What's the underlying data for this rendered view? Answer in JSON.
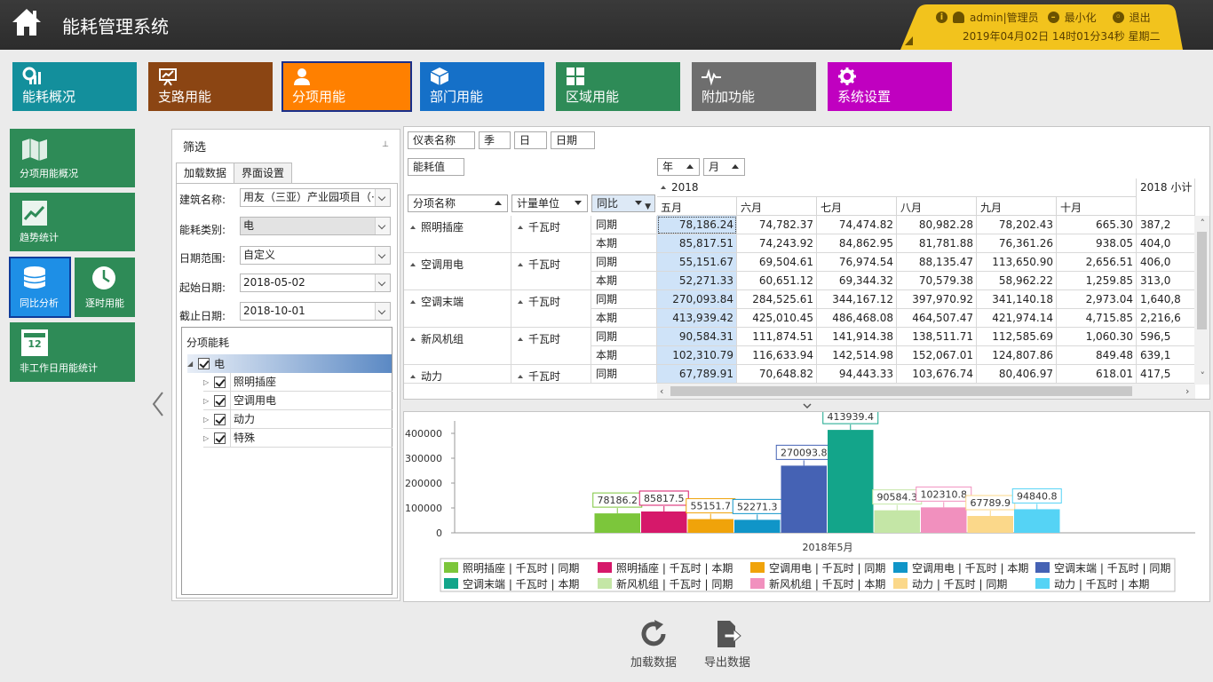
{
  "header": {
    "app_title": "能耗管理系统",
    "user": "admin|管理员",
    "minimize": "最小化",
    "logout": "退出",
    "datetime": "2019年04月02日 14时01分34秒 星期二"
  },
  "top_tiles": [
    {
      "label": "能耗概况",
      "color": "#138f9c",
      "icon": "dashboard-icon"
    },
    {
      "label": "支路用能",
      "color": "#8b4513",
      "icon": "presentation-chart-icon"
    },
    {
      "label": "分项用能",
      "color": "#ff8000",
      "icon": "user-icon"
    },
    {
      "label": "部门用能",
      "color": "#1570c8",
      "icon": "box-icon"
    },
    {
      "label": "区域用能",
      "color": "#2e8b57",
      "icon": "grid-icon"
    },
    {
      "label": "附加功能",
      "color": "#6e6e6e",
      "icon": "pulse-icon"
    },
    {
      "label": "系统设置",
      "color": "#c000c0",
      "icon": "gear-icon"
    }
  ],
  "left_tiles": [
    {
      "label": "分项用能概况"
    },
    {
      "label": "趋势统计"
    },
    {
      "label": "同比分析"
    },
    {
      "label": "逐时用能"
    },
    {
      "label": "非工作日用能统计",
      "icon_text": "12"
    }
  ],
  "filter": {
    "title": "筛选",
    "pin": "⊥",
    "tabs": [
      "加载数据",
      "界面设置"
    ],
    "fields": [
      {
        "label": "建筑名称:",
        "value": "用友（三亚）产业园项目（·"
      },
      {
        "label": "能耗类别:",
        "value": "电"
      },
      {
        "label": "日期范围:",
        "value": "自定义"
      },
      {
        "label": "起始日期:",
        "value": "2018-05-02"
      },
      {
        "label": "截止日期:",
        "value": "2018-10-01"
      }
    ],
    "tree_title": "分项能耗",
    "tree_root": "电",
    "tree_children": [
      "照明插座",
      "空调用电",
      "动力",
      "特殊"
    ]
  },
  "pivot": {
    "filter_fields": [
      "仪表名称",
      "季",
      "日",
      "日期"
    ],
    "data_field": "能耗值",
    "col_fields": [
      "年",
      "月"
    ],
    "row_fields": [
      "分项名称",
      "计量单位",
      "同比"
    ],
    "year": "2018",
    "year_subtotal": "2018 小计",
    "months": [
      "五月",
      "六月",
      "七月",
      "八月",
      "九月",
      "十月"
    ],
    "unit": "千瓦时",
    "period_labels": [
      "同期",
      "本期"
    ],
    "rows": [
      {
        "name": "照明插座",
        "same": [
          "78,186.24",
          "74,782.37",
          "74,474.82",
          "80,982.28",
          "78,202.43",
          "665.30",
          "387,2"
        ],
        "cur": [
          "85,817.51",
          "74,243.92",
          "84,862.95",
          "81,781.88",
          "76,361.26",
          "938.05",
          "404,0"
        ]
      },
      {
        "name": "空调用电",
        "same": [
          "55,151.67",
          "69,504.61",
          "76,974.54",
          "88,135.47",
          "113,650.90",
          "2,656.51",
          "406,0"
        ],
        "cur": [
          "52,271.33",
          "60,651.12",
          "69,344.32",
          "70,579.38",
          "58,962.22",
          "1,259.85",
          "313,0"
        ]
      },
      {
        "name": "空调末端",
        "same": [
          "270,093.84",
          "284,525.61",
          "344,167.12",
          "397,970.92",
          "341,140.18",
          "2,973.04",
          "1,640,8"
        ],
        "cur": [
          "413,939.42",
          "425,010.45",
          "486,468.08",
          "464,507.47",
          "421,974.14",
          "4,715.85",
          "2,216,6"
        ]
      },
      {
        "name": "新风机组",
        "same": [
          "90,584.31",
          "111,874.51",
          "141,914.38",
          "138,511.71",
          "112,585.69",
          "1,060.30",
          "596,5"
        ],
        "cur": [
          "102,310.79",
          "116,633.94",
          "142,514.98",
          "152,067.01",
          "124,807.86",
          "849.48",
          "639,1"
        ]
      },
      {
        "name": "动力",
        "same": [
          "67,789.91",
          "70,648.82",
          "94,443.33",
          "103,676.74",
          "80,406.97",
          "618.01",
          "417,5"
        ]
      }
    ]
  },
  "chart_data": {
    "type": "bar",
    "categories": [
      "2018年5月"
    ],
    "ylim": [
      0,
      450000
    ],
    "yticks": [
      "0",
      "100000",
      "200000",
      "300000",
      "400000"
    ],
    "series": [
      {
        "name": "照明插座 | 千瓦时 | 同期",
        "value": 78186.2,
        "label": "78186.2",
        "color": "#7cc63b"
      },
      {
        "name": "照明插座 | 千瓦时 | 本期",
        "value": 85817.5,
        "label": "85817.5",
        "color": "#d6186a"
      },
      {
        "name": "空调用电 | 千瓦时 | 同期",
        "value": 55151.7,
        "label": "55151.7",
        "color": "#f0a30a"
      },
      {
        "name": "空调用电 | 千瓦时 | 本期",
        "value": 52271.3,
        "label": "52271.3",
        "color": "#1095c8"
      },
      {
        "name": "空调末端 | 千瓦时 | 同期",
        "value": 270093.8,
        "label": "270093.8",
        "color": "#4562b4"
      },
      {
        "name": "空调末端 | 千瓦时 | 本期",
        "value": 413939.4,
        "label": "413939.4",
        "color": "#13a58a"
      },
      {
        "name": "新风机组 | 千瓦时 | 同期",
        "value": 90584.3,
        "label": "90584.3",
        "color": "#c4e6a6"
      },
      {
        "name": "新风机组 | 千瓦时 | 本期",
        "value": 102310.8,
        "label": "102310.8",
        "color": "#f190be"
      },
      {
        "name": "动力 | 千瓦时 | 同期",
        "value": 67789.9,
        "label": "67789.9",
        "color": "#fbd88a"
      },
      {
        "name": "动力 | 千瓦时 | 本期",
        "value": 94840.8,
        "label": "94840.8",
        "color": "#55d3f5"
      }
    ]
  },
  "bottom_buttons": {
    "load": "加载数据",
    "export": "导出数据"
  }
}
